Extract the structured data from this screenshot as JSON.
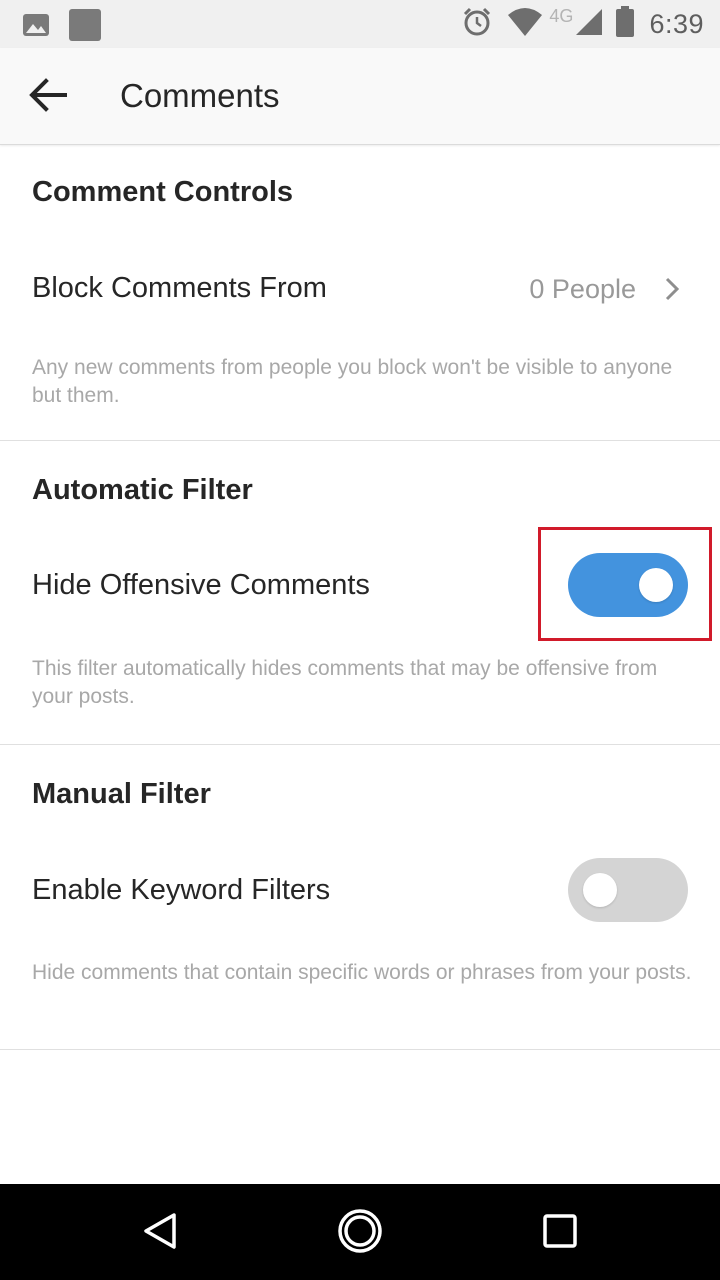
{
  "status_bar": {
    "time": "6:39",
    "network": "4G",
    "left_icons": [
      "image-icon",
      "app-square-icon"
    ],
    "right_icons": [
      "alarm-icon",
      "wifi-icon",
      "signal-icon",
      "battery-icon"
    ]
  },
  "app_bar": {
    "title": "Comments",
    "back_icon": "arrow-left-icon"
  },
  "sections": {
    "comment_controls": {
      "heading": "Comment Controls",
      "block_label": "Block Comments From",
      "block_value": "0 People",
      "description": "Any new comments from people you block won't be visible to anyone but them."
    },
    "automatic_filter": {
      "heading": "Automatic Filter",
      "label": "Hide Offensive Comments",
      "enabled": true,
      "description": "This filter automatically hides comments that may be offensive from your posts."
    },
    "manual_filter": {
      "heading": "Manual Filter",
      "label": "Enable Keyword Filters",
      "enabled": false,
      "description": "Hide comments that contain specific words or phrases from your posts."
    }
  },
  "colors": {
    "toggle_on": "#4393de",
    "toggle_off": "#d4d4d4",
    "highlight": "#d11a2a"
  },
  "nav_bar": {
    "icons": [
      "back-triangle-icon",
      "home-circle-icon",
      "recents-square-icon"
    ]
  }
}
